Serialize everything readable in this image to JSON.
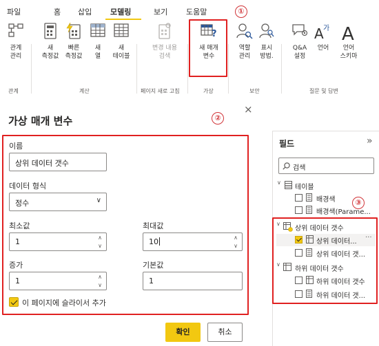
{
  "ribbon": {
    "tabs": [
      {
        "label": "파일"
      },
      {
        "label": "홈"
      },
      {
        "label": "삽입"
      },
      {
        "label": "모델링",
        "active": true
      },
      {
        "label": "보기"
      },
      {
        "label": "도움말"
      }
    ],
    "buttons": {
      "manage_relationships": "관계\n관리",
      "new_measure": "새\n측정값",
      "quick_measure": "빠른\n측정값",
      "new_column": "새\n열",
      "new_table": "새\n테이블",
      "view_changes": "변경 내용\n검색",
      "new_parameter": "새 매개\n변수",
      "roles": "역할\n관리",
      "view_as": "표시\n방법.",
      "qa_setup": "Q&A\n설정",
      "language": "언어",
      "linguistic_schema": "언어\n스키마"
    },
    "groups": {
      "relationships": "관계",
      "calculations": "계산",
      "page_refresh": "페이지 새로 고침",
      "what_if": "가상",
      "security": "보안",
      "qa": "질문 및 답변"
    },
    "markers": {
      "one": "①",
      "two": "②",
      "three": "③"
    }
  },
  "dialog": {
    "title": "가상 매개 변수",
    "close_glyph": "×",
    "name_label": "이름",
    "name_value": "상위 데이터 갯수",
    "datatype_label": "데이터 형식",
    "datatype_value": "정수",
    "min_label": "최소값",
    "min_value": "1",
    "max_label": "최대값",
    "max_value": "10",
    "increment_label": "증가",
    "increment_value": "1",
    "default_label": "기본값",
    "default_value": "1",
    "add_slicer_label": "이 페이지에 슬라이서 추가",
    "add_slicer_checked": true,
    "ok_label": "확인",
    "cancel_label": "취소"
  },
  "fields_pane": {
    "title": "필드",
    "collapse_glyph": "»",
    "search_placeholder": "검색",
    "tree": {
      "table_group": "테이블",
      "table_item_1": "배경색",
      "table_item_2": "배경색(Parame...",
      "param_top": "상위 데이터 갯수",
      "param_top_item_1": "상위 데이터...",
      "param_top_item_1_checked": true,
      "param_top_item_2": "상위 데이터 갯...",
      "param_bottom": "하위 데이터 갯수",
      "param_bottom_item_1": "하위 데이터 갯수",
      "param_bottom_item_2": "하위 데이터 갯...",
      "more_glyph": "···"
    }
  },
  "colors": {
    "accent": "#f2c811",
    "highlight_red": "#e02020",
    "marker_red": "#d13438"
  }
}
